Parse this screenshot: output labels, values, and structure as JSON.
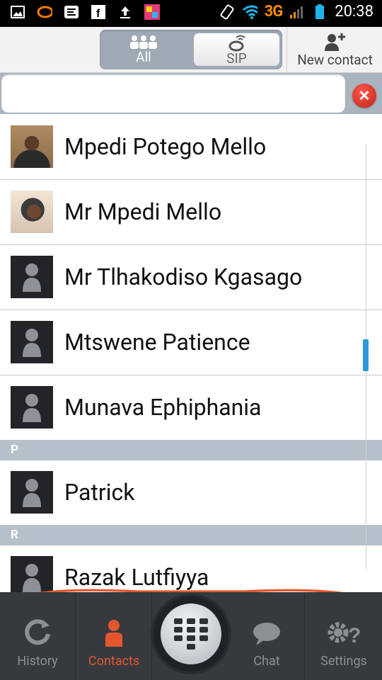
{
  "status_bar": {
    "network": "3G",
    "time": "20:38"
  },
  "toolbar": {
    "segment_all_label": "All",
    "segment_sip_label": "SIP",
    "new_contact_label": "New contact"
  },
  "search": {
    "value": "",
    "placeholder": ""
  },
  "contacts": [
    {
      "name": "Mpedi Potego Mello"
    },
    {
      "name": "Mr Mpedi Mello"
    },
    {
      "name": "Mr Tlhakodiso Kgasago"
    },
    {
      "name": "Mtswene Patience"
    },
    {
      "name": "Munava Ephiphania"
    }
  ],
  "sections": {
    "p": {
      "letter": "P",
      "contacts": [
        {
          "name": "Patrick"
        }
      ]
    },
    "r": {
      "letter": "R",
      "contacts": [
        {
          "name": "Razak Lutfiyya"
        }
      ]
    }
  },
  "bottom_nav": {
    "history_label": "History",
    "contacts_label": "Contacts",
    "chat_label": "Chat",
    "settings_label": "Settings"
  },
  "colors": {
    "accent": "#e4572e",
    "scroll_thumb": "#2a9bd8",
    "network": "#ff8a00"
  }
}
